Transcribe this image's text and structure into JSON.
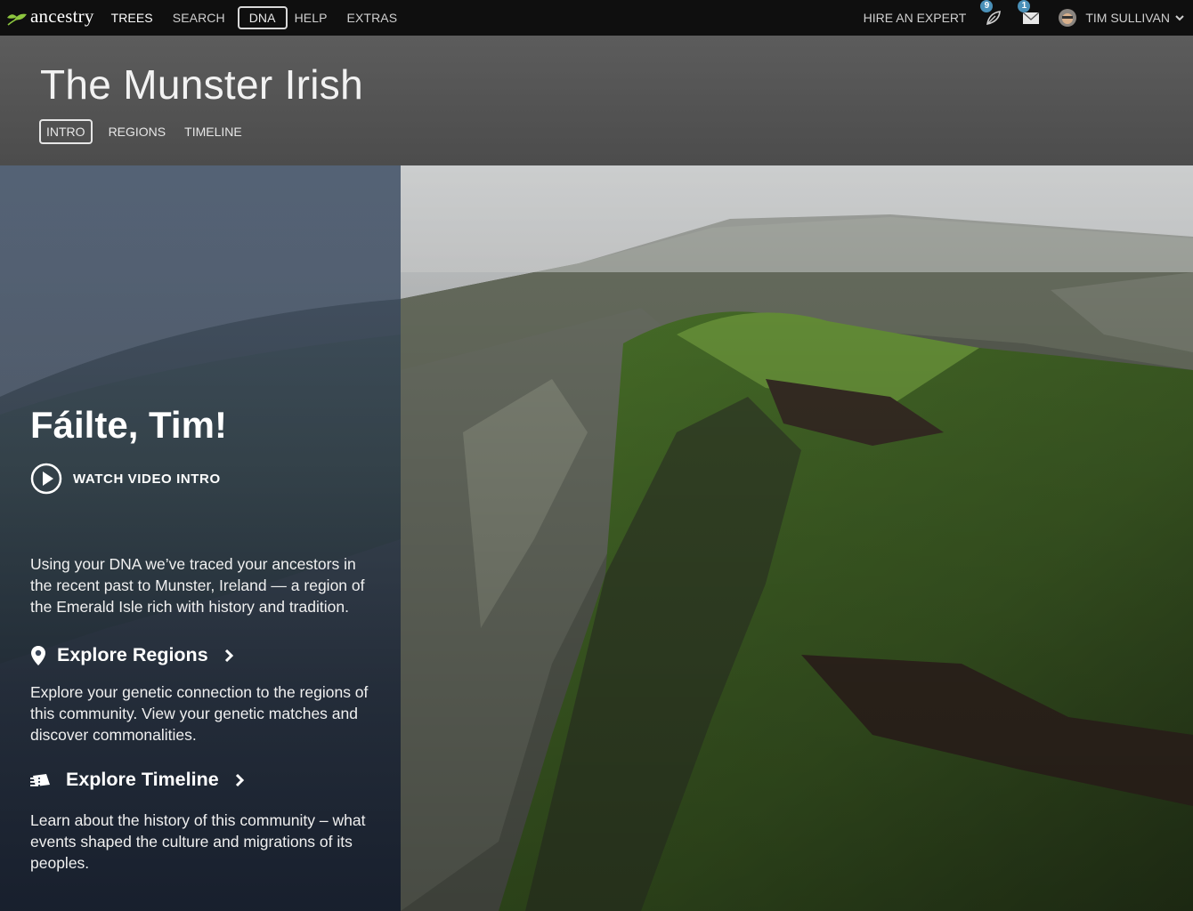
{
  "topnav": {
    "logo_text": "ancestry",
    "links": [
      "TREES",
      "SEARCH",
      "DNA",
      "HELP",
      "EXTRAS"
    ],
    "hire_expert": "HIRE AN EXPERT",
    "hints_count": "9",
    "messages_count": "1",
    "user_name": "TIM SULLIVAN"
  },
  "header": {
    "title": "The Munster Irish",
    "tabs": [
      "INTRO",
      "REGIONS",
      "TIMELINE"
    ]
  },
  "intro_panel": {
    "greeting": "Fáilte, Tim!",
    "watch_video": "WATCH VIDEO INTRO",
    "intro_text": "Using your DNA we’ve traced your ancestors in the recent past to Munster, Ireland — a region of the Emerald Isle rich with history and tradition.",
    "explore_regions": "Explore Regions",
    "regions_desc": "Explore your genetic connection to the regions of this community.  View your genetic matches and discover commonalities.",
    "explore_timeline": "Explore Timeline",
    "timeline_desc": "Learn about the history of this community – what events shaped the culture and migrations of its peoples."
  },
  "icons": [
    "ancestry-leaf-icon",
    "hints-leaf-icon",
    "mail-icon",
    "chevron-down-icon",
    "play-circle-icon",
    "map-pin-icon",
    "timeline-icon",
    "chevron-right-icon"
  ],
  "colors": {
    "nav_bg": "#0f0f0f",
    "header_bg": "#555555",
    "logo_green": "#8dc63f",
    "badge_blue": "#4a90b8"
  }
}
